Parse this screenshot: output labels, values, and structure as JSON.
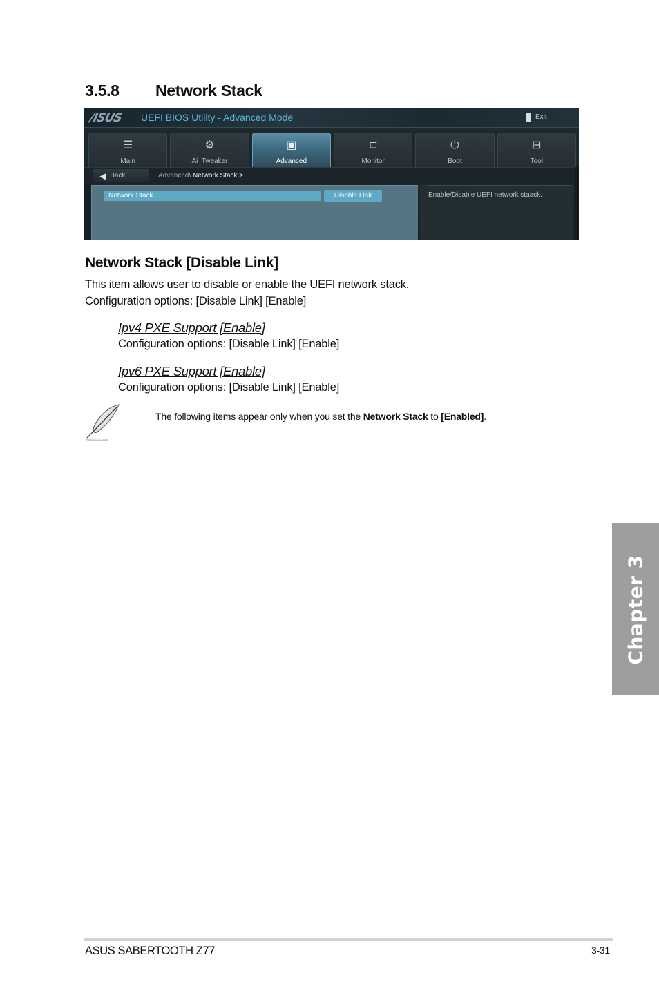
{
  "section": {
    "number": "3.5.8",
    "title": "Network Stack"
  },
  "bios": {
    "logo": "/ISUS",
    "title": "UEFI BIOS Utility - Advanced Mode",
    "exit_label": "Exit",
    "tabs": [
      {
        "label": "Main",
        "icon": "list-icon",
        "glyph": "☰",
        "active": false
      },
      {
        "label": "Ai  Tweaker",
        "icon": "tweaker-icon",
        "glyph": "⚙",
        "active": false
      },
      {
        "label": "Advanced",
        "icon": "advanced-icon",
        "glyph": "▣",
        "active": true
      },
      {
        "label": "Monitor",
        "icon": "monitor-icon",
        "glyph": "⊏",
        "active": false
      },
      {
        "label": "Boot",
        "icon": "power-icon",
        "glyph": "⏻",
        "active": false
      },
      {
        "label": "Tool",
        "icon": "toolbox-icon",
        "glyph": "⊟",
        "active": false
      }
    ],
    "back_label": "Back",
    "breadcrumb": {
      "parent": "Advanced\\",
      "current": "Network Stack",
      "separator": ">"
    },
    "setting": {
      "label": "Network Stack",
      "value": "Disable Link"
    },
    "help_text": "Enable/Disable UEFI network staack.",
    "colors": {
      "accent": "#5ea9c4",
      "title": "#5fb4d4",
      "panel": "#577482"
    }
  },
  "item": {
    "heading": "Network Stack [Disable Link]",
    "description": "This item allows user to disable or enable the UEFI network stack.",
    "options": "Configuration options: [Disable Link] [Enable]",
    "sub_items": [
      {
        "heading": "Ipv4 PXE Support [Enable]",
        "options": "Configuration options: [Disable Link] [Enable]"
      },
      {
        "heading": "Ipv6 PXE Support [Enable]",
        "options": "Configuration options: [Disable Link] [Enable]"
      }
    ]
  },
  "note": {
    "prefix": "The following items appear only when you set the ",
    "bold1": "Network Stack",
    "middle": " to ",
    "bold2": "[Enabled]",
    "suffix": "."
  },
  "chapter_tab": "Chapter 3",
  "footer": {
    "product": "ASUS SABERTOOTH Z77",
    "page": "3-31"
  }
}
